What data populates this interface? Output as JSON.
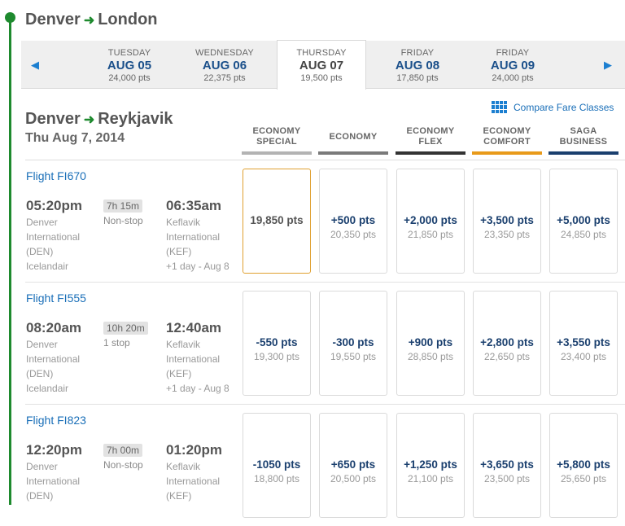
{
  "route": {
    "origin": "Denver",
    "destination": "London",
    "arrow": "➜"
  },
  "date_strip": {
    "prev_icon": "◀",
    "next_icon": "▶",
    "tabs": [
      {
        "day": "TUESDAY",
        "date": "AUG 05",
        "points": "24,000 pts"
      },
      {
        "day": "WEDNESDAY",
        "date": "AUG 06",
        "points": "22,375 pts"
      },
      {
        "day": "THURSDAY",
        "date": "AUG 07",
        "points": "19,500 pts",
        "selected": true
      },
      {
        "day": "FRIDAY",
        "date": "AUG 08",
        "points": "17,850 pts"
      },
      {
        "day": "FRIDAY",
        "date": "AUG 09",
        "points": "24,000 pts"
      }
    ]
  },
  "leg": {
    "origin": "Denver",
    "destination": "Reykjavik",
    "date": "Thu Aug 7, 2014"
  },
  "compare_link": "Compare Fare Classes",
  "fare_classes": [
    {
      "line1": "ECONOMY",
      "line2": "SPECIAL",
      "color": "#b3b3b3"
    },
    {
      "line1": "ECONOMY",
      "line2": "",
      "color": "#7a7a7a"
    },
    {
      "line1": "ECONOMY",
      "line2": "FLEX",
      "color": "#333333"
    },
    {
      "line1": "ECONOMY",
      "line2": "COMFORT",
      "color": "#e89a1a"
    },
    {
      "line1": "SAGA",
      "line2": "BUSINESS",
      "color": "#1a3f6e"
    }
  ],
  "flights": [
    {
      "flight_no": "Flight FI670",
      "dep_time": "05:20pm",
      "duration": "7h 15m",
      "stops": "Non-stop",
      "arr_time": "06:35am",
      "dep_airport": [
        "Denver",
        "International",
        "(DEN)",
        "Icelandair"
      ],
      "arr_airport": [
        "Keflavik",
        "International",
        "(KEF)",
        "+1 day - Aug 8"
      ],
      "fares": [
        {
          "main": "19,850 pts",
          "sub": "",
          "selected": true
        },
        {
          "main": "+500 pts",
          "sub": "20,350 pts"
        },
        {
          "main": "+2,000 pts",
          "sub": "21,850 pts"
        },
        {
          "main": "+3,500 pts",
          "sub": "23,350 pts"
        },
        {
          "main": "+5,000 pts",
          "sub": "24,850 pts"
        }
      ]
    },
    {
      "flight_no": "Flight FI555",
      "dep_time": "08:20am",
      "duration": "10h 20m",
      "stops": "1 stop",
      "arr_time": "12:40am",
      "dep_airport": [
        "Denver",
        "International",
        "(DEN)",
        "Icelandair"
      ],
      "arr_airport": [
        "Keflavik",
        "International",
        "(KEF)",
        "+1 day - Aug 8"
      ],
      "fares": [
        {
          "main": "-550 pts",
          "sub": "19,300 pts"
        },
        {
          "main": "-300 pts",
          "sub": "19,550 pts"
        },
        {
          "main": "+900 pts",
          "sub": "28,850 pts"
        },
        {
          "main": "+2,800 pts",
          "sub": "22,650 pts"
        },
        {
          "main": "+3,550 pts",
          "sub": "23,400 pts"
        }
      ]
    },
    {
      "flight_no": "Flight FI823",
      "dep_time": "12:20pm",
      "duration": "7h 00m",
      "stops": "Non-stop",
      "arr_time": "01:20pm",
      "dep_airport": [
        "Denver",
        "International",
        "(DEN)",
        ""
      ],
      "arr_airport": [
        "Keflavik",
        "International",
        "(KEF)",
        ""
      ],
      "fares": [
        {
          "main": "-1050 pts",
          "sub": "18,800 pts"
        },
        {
          "main": "+650 pts",
          "sub": "20,500 pts"
        },
        {
          "main": "+1,250 pts",
          "sub": "21,100 pts"
        },
        {
          "main": "+3,650 pts",
          "sub": "23,500 pts"
        },
        {
          "main": "+5,800 pts",
          "sub": "25,650 pts"
        }
      ]
    }
  ]
}
